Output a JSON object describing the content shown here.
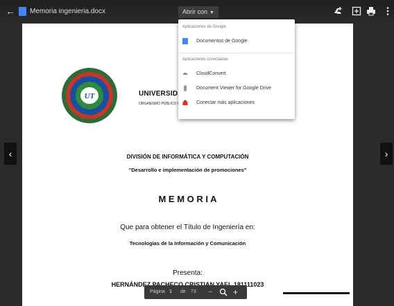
{
  "topbar": {
    "filename": "Memoria ingenieria.docx",
    "open_with_label": "Abrir con"
  },
  "menu": {
    "section_suggested": "Aplicaciones de Google",
    "item_google_docs": "Documentos de Google",
    "section_connected": "Aplicaciones conectadas",
    "item_cloudconvert": "CloudConvert",
    "item_doc_viewer": "Document Viewer for Google Drive",
    "item_connect_more": "Conectar más aplicaciones"
  },
  "document": {
    "university": "UNIVERSIDAD",
    "university_sub": "ORGANISMO PÚBLICO D",
    "division": "DIVISIÓN DE INFORMÁTICA Y COMPUTACIÓN",
    "project": "\"Desarrollo e implementación de promociones\"",
    "memoria": "M E M O R I A",
    "purpose": "Que para obtener el Título de Ingeniería en:",
    "career": "Tecnologías de la Información y Comunicación",
    "presenta": "Presenta:",
    "author": "HERNÁNDEZ PACHECO CRISTIAN YAEL 181111023"
  },
  "pagebar": {
    "label": "Página",
    "current": "1",
    "separator": "de",
    "total": "73"
  }
}
